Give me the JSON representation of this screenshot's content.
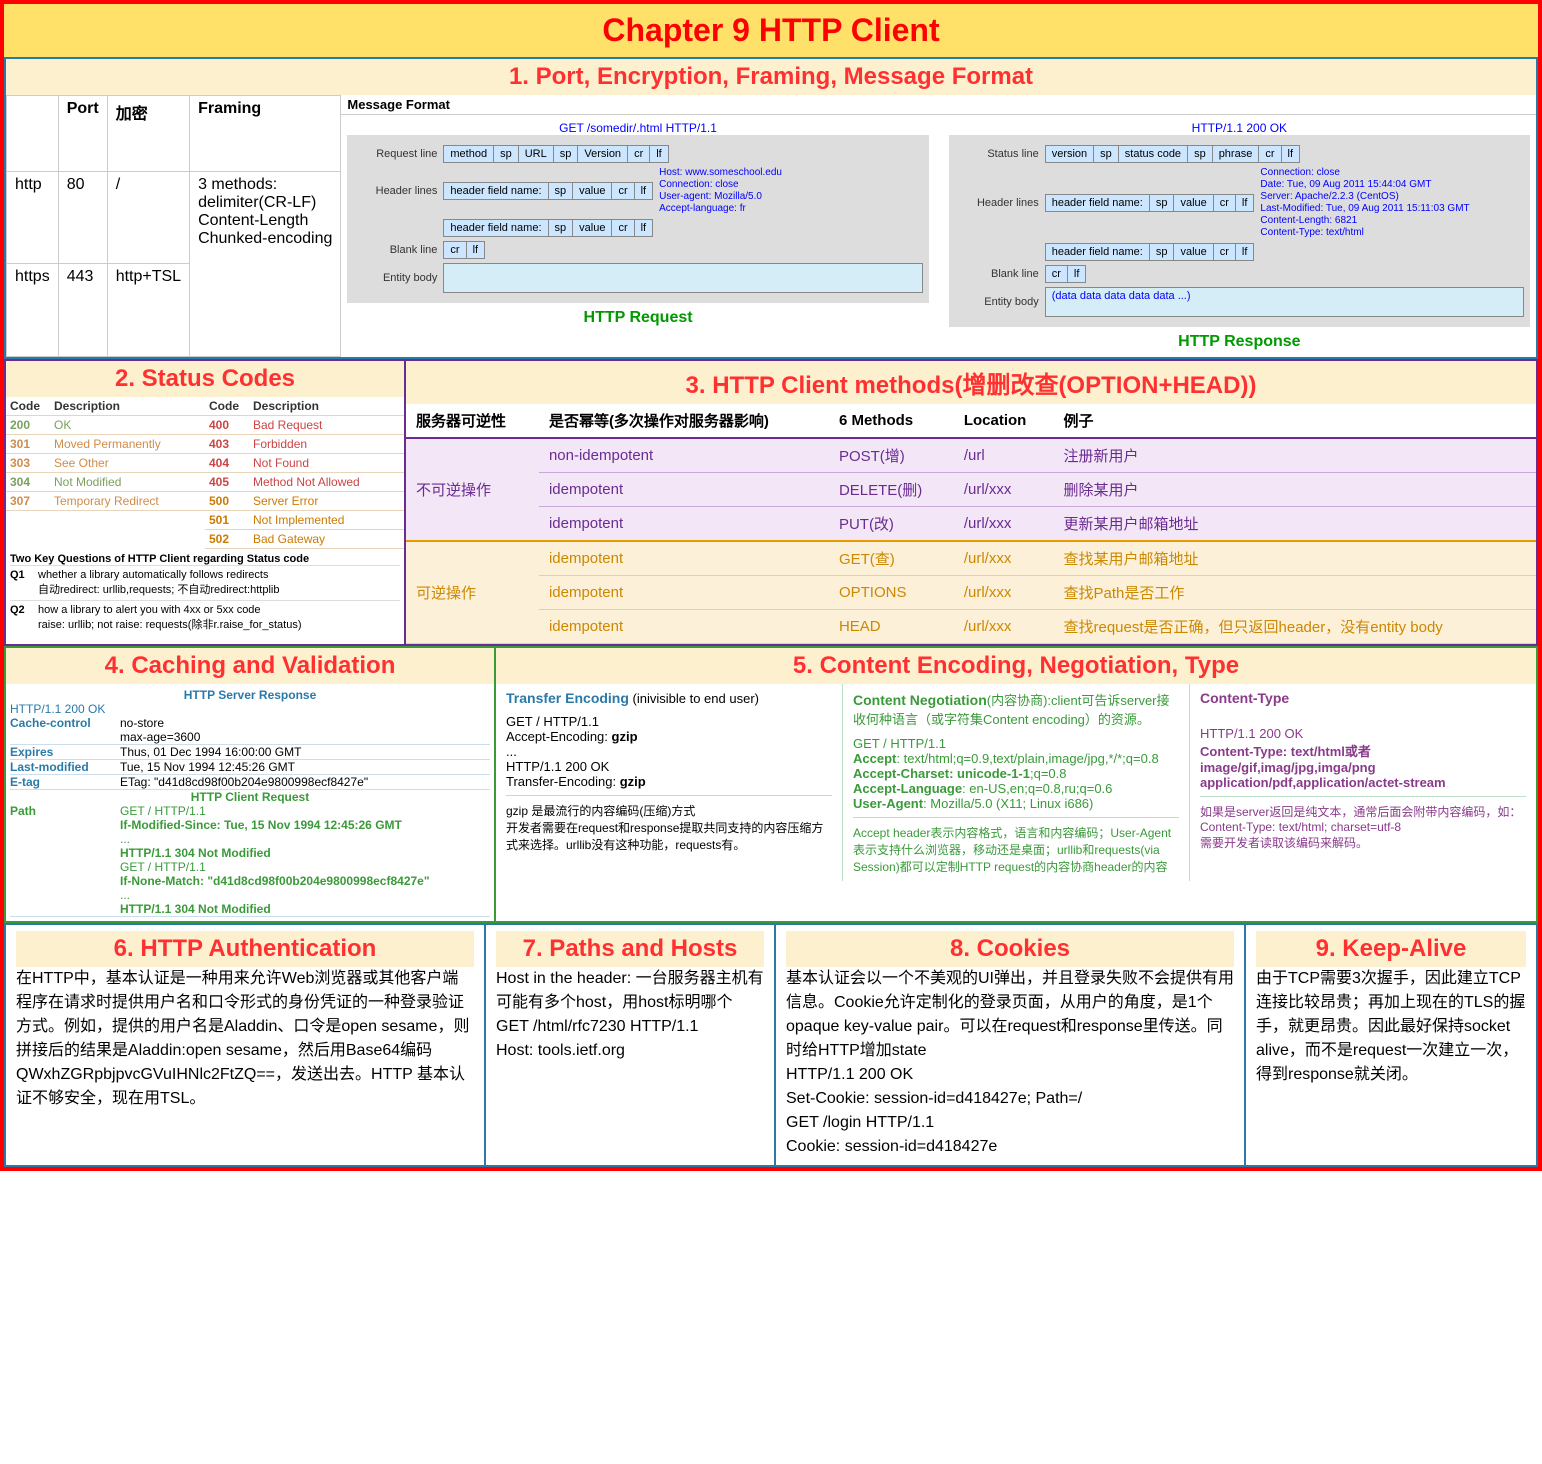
{
  "title": "Chapter 9 HTTP Client",
  "s1": {
    "title": "1. Port, Encryption, Framing, Message Format",
    "cols": [
      "",
      "Port",
      "加密",
      "Framing",
      "Message Format"
    ],
    "rows": [
      {
        "proto": "http",
        "port": "80",
        "enc": "/",
        "framing": "3 methods:\ndelimiter(CR-LF)\nContent-Length\nChunked-encoding"
      },
      {
        "proto": "https",
        "port": "443",
        "enc": "http+TSL",
        "framing": ""
      }
    ],
    "req": {
      "top": "GET /somedir/.html HTTP/1.1",
      "labels": [
        "Request line",
        "Header lines",
        "Blank line",
        "Entity body"
      ],
      "line1": [
        "method",
        "sp",
        "URL",
        "sp",
        "Version",
        "cr",
        "lf"
      ],
      "hdr": [
        "header field name:",
        "sp",
        "value",
        "cr",
        "lf"
      ],
      "blank": [
        "cr",
        "lf"
      ],
      "note": "Host: www.someschool.edu\nConnection: close\nUser-agent: Mozilla/5.0\nAccept-language: fr",
      "caption": "HTTP Request"
    },
    "res": {
      "top": "HTTP/1.1 200 OK",
      "labels": [
        "Status line",
        "Header lines",
        "Blank line",
        "Entity body"
      ],
      "line1": [
        "version",
        "sp",
        "status code",
        "sp",
        "phrase",
        "cr",
        "lf"
      ],
      "hdr": [
        "header field name:",
        "sp",
        "value",
        "cr",
        "lf"
      ],
      "blank": [
        "cr",
        "lf"
      ],
      "note": "Connection: close\nDate: Tue, 09 Aug 2011 15:44:04 GMT\nServer: Apache/2.2.3 (CentOS)\nLast-Modified: Tue, 09 Aug 2011 15:11:03 GMT\nContent-Length: 6821\nContent-Type: text/html",
      "body": "(data data data data data ...)",
      "caption": "HTTP Response"
    }
  },
  "s2": {
    "title": "2. Status Codes",
    "head1": "Code",
    "head2": "Description",
    "left": [
      {
        "c": "200",
        "d": "OK",
        "cls": "c200"
      },
      {
        "c": "301",
        "d": "Moved Permanently",
        "cls": "c301"
      },
      {
        "c": "303",
        "d": "See Other",
        "cls": "c303"
      },
      {
        "c": "304",
        "d": "Not Modified",
        "cls": "c304"
      },
      {
        "c": "307",
        "d": "Temporary Redirect",
        "cls": "c307"
      }
    ],
    "right": [
      {
        "c": "400",
        "d": "Bad Request",
        "cls": "c400"
      },
      {
        "c": "403",
        "d": "Forbidden",
        "cls": "c403"
      },
      {
        "c": "404",
        "d": "Not Found",
        "cls": "c404"
      },
      {
        "c": "405",
        "d": "Method Not Allowed",
        "cls": "c405"
      },
      {
        "c": "500",
        "d": "Server Error",
        "cls": "c500"
      },
      {
        "c": "501",
        "d": "Not Implemented",
        "cls": "c501"
      },
      {
        "c": "502",
        "d": "Bad Gateway",
        "cls": "c502"
      }
    ],
    "qtitle": "Two Key Questions of HTTP Client regarding Status code",
    "q1a": "whether a library automatically follows redirects",
    "q1b": "自动redirect: urllib,requests; 不自动redirect:httplib",
    "q2a": "how a library to alert you with 4xx or 5xx code",
    "q2b": "raise: urllib; not raise: requests(除非r.raise_for_status)"
  },
  "s3": {
    "title": "3. HTTP  Client methods(增删改查(OPTION+HEAD))",
    "cols": [
      "服务器可逆性",
      "是否幂等(多次操作对服务器影响)",
      "6 Methods",
      "Location",
      "例子"
    ],
    "g1lab": "不可逆操作",
    "g1": [
      {
        "idem": "non-idempotent",
        "m": "POST(增)",
        "loc": "/url",
        "ex": "注册新用户"
      },
      {
        "idem": "idempotent",
        "m": "DELETE(删)",
        "loc": "/url/xxx",
        "ex": "删除某用户"
      },
      {
        "idem": "idempotent",
        "m": "PUT(改)",
        "loc": "/url/xxx",
        "ex": "更新某用户邮箱地址"
      }
    ],
    "g2lab": "可逆操作",
    "g2": [
      {
        "idem": "idempotent",
        "m": "GET(查)",
        "loc": "/url/xxx",
        "ex": "查找某用户邮箱地址"
      },
      {
        "idem": "idempotent",
        "m": "OPTIONS",
        "loc": "/url/xxx",
        "ex": "查找Path是否工作"
      },
      {
        "idem": "idempotent",
        "m": "HEAD",
        "loc": "/url/xxx",
        "ex": "查找request是否正确，但只返回header，没有entity body"
      }
    ]
  },
  "s4": {
    "title": "4. Caching and Validation",
    "resp_h": "HTTP Server Response",
    "status": "HTTP/1.1 200 OK",
    "cache_k": "Cache-control",
    "cache_v1": "no-store",
    "cache_v2": "max-age=3600",
    "exp_k": "Expires",
    "exp_v": "Thus, 01 Dec 1994 16:00:00 GMT",
    "lm_k": "Last-modified",
    "lm_v": "Tue, 15 Nov 1994 12:45:26 GMT",
    "et_k": "E-tag",
    "et_v": "ETag: \"d41d8cd98f00b204e9800998ecf8427e\"",
    "req_h": "HTTP Client Request",
    "path_k": "Path",
    "req1_l1": "GET / HTTP/1.1",
    "req1_l2": "If-Modified-Since: Tue, 15 Nov 1994 12:45:26 GMT",
    "req1_l3": "...",
    "req1_l4": "HTTP/1.1 304 Not Modified",
    "req2_l1": "GET / HTTP/1.1",
    "req2_l2": "If-None-Match: \"d41d8cd98f00b204e9800998ecf8427e\"",
    "req2_l3": "...",
    "req2_l4": "HTTP/1.1 304 Not Modified"
  },
  "s5": {
    "title": "5. Content Encoding, Negotiation, Type",
    "c1h": "Transfer Encoding",
    "c1h2": " (inivisible to end user)",
    "c1_1": "GET / HTTP/1.1",
    "c1_2": "Accept-Encoding: gzip",
    "c1_3": "...",
    "c1_4": "HTTP/1.1 200 OK",
    "c1_5": "Transfer-Encoding: gzip",
    "c1_note": "gzip 是最流行的内容编码(压缩)方式\n开发者需要在request和response提取共同支持的内容压缩方式来选择。urllib没有这种功能，requests有。",
    "c2h": "Content Negotiation",
    "c2h2": "(内容协商):client可告诉server接收何种语言（或字符集Content encoding）的资源。",
    "c2_1": "GET / HTTP/1.1",
    "c2_2": "Accept: text/html;q=0.9,text/plain,image/jpg,*/*;q=0.8",
    "c2_3": "Accept-Charset: unicode-1-1;q=0.8",
    "c2_4": "Accept-Language: en-US,en;q=0.8,ru;q=0.6",
    "c2_5": "User-Agent: Mozilla/5.0 (X11; Linux i686)",
    "c2_note": "Accept header表示内容格式，语言和内容编码；User-Agent表示支持什么浏览器，移动还是桌面；urllib和requests(via Session)都可以定制HTTP request的内容协商header的内容",
    "c3h": "Content-Type",
    "c3_1": "HTTP/1.1 200 OK",
    "c3_2": "Content-Type: text/html或者image/gif,imag/jpg,imga/png\napplication/pdf,application/actet-stream",
    "c3_note": "如果是server返回是纯文本，通常后面会附带内容编码，如：\nContent-Type: text/html; charset=utf-8\n需要开发者读取该编码来解码。"
  },
  "s6": {
    "title": "6. HTTP Authentication",
    "body": "在HTTP中，基本认证是一种用来允许Web浏览器或其他客户端程序在请求时提供用户名和口令形式的身份凭证的一种登录验证方式。例如，提供的用户名是Aladdin、口令是open sesame，则拼接后的结果是Aladdin:open sesame，然后用Base64编码QWxhZGRpbjpvcGVuIHNlc2FtZQ==，发送出去。HTTP 基本认证不够安全，现在用TSL。"
  },
  "s7": {
    "title": "7. Paths and Hosts",
    "l1": "Host in the header: 一台服务器主机有可能有多个host，用host标明哪个",
    "l2": "GET /html/rfc7230 HTTP/1.1",
    "l3": "Host: tools.ietf.org"
  },
  "s8": {
    "title": "8. Cookies",
    "body": "基本认证会以一个不美观的UI弹出，并且登录失败不会提供有用信息。Cookie允许定制化的登录页面，从用户的角度，是1个opaque key-value pair。可以在request和response里传送。同时给HTTP增加state",
    "l1": "HTTP/1.1 200 OK",
    "l2": "Set-Cookie: session-id=d418427e; Path=/",
    "l3": "GET /login HTTP/1.1",
    "l4": "Cookie: session-id=d418427e"
  },
  "s9": {
    "title": "9. Keep-Alive",
    "body": "由于TCP需要3次握手，因此建立TCP连接比较昂贵；再加上现在的TLS的握手，就更昂贵。因此最好保持socket alive，而不是request一次建立一次，得到response就关闭。"
  }
}
